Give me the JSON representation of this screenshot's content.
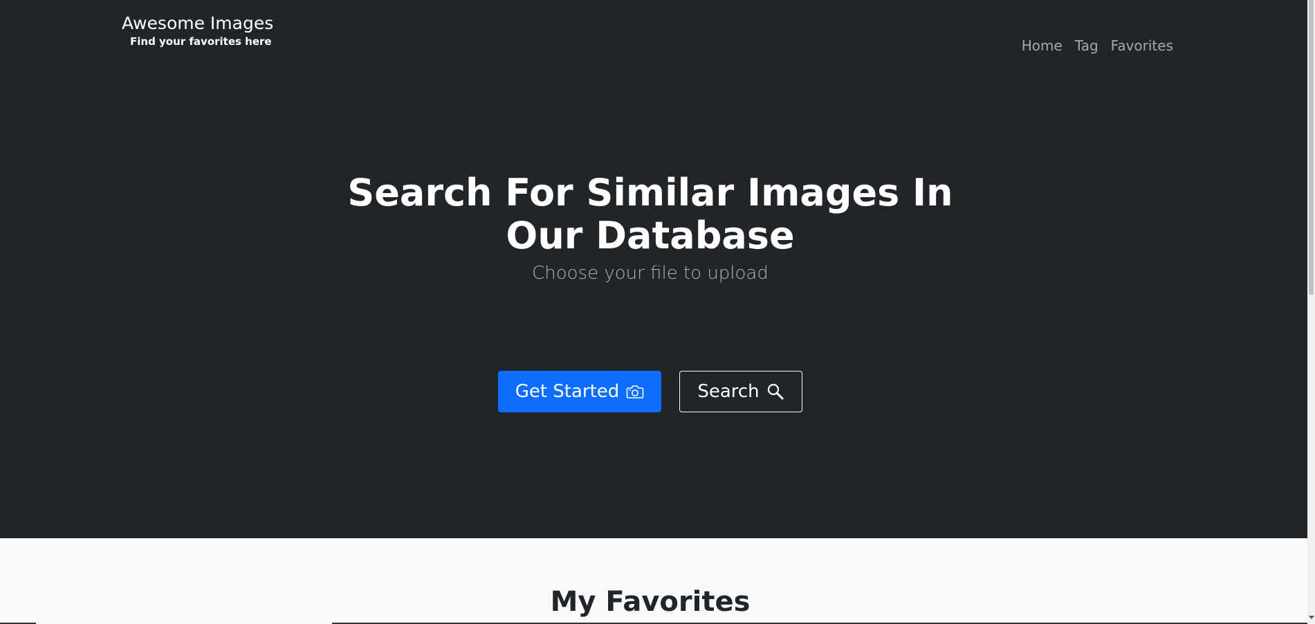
{
  "brand": {
    "title": "Awesome Images",
    "subtitle": "Find your favorites here"
  },
  "nav": {
    "items": [
      "Home",
      "Tag",
      "Favorites"
    ]
  },
  "hero": {
    "headline_line1": "Search For Similar Images In",
    "headline_line2": "Our Database",
    "subtitle": "Choose your file to upload",
    "primary_button": "Get Started",
    "secondary_button": "Search"
  },
  "favorites": {
    "title": "My Favorites"
  },
  "colors": {
    "hero_bg": "#212529",
    "primary": "#0d6efd",
    "section_bg": "#f8f9fa"
  },
  "icons": {
    "primary_button_icon": "camera-icon",
    "secondary_button_icon": "search-icon"
  }
}
